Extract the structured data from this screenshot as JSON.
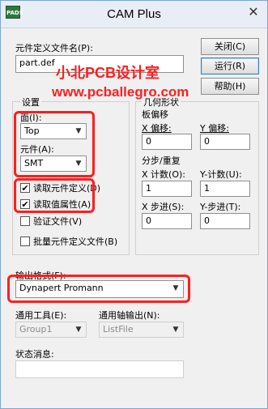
{
  "window": {
    "title": "CAM Plus",
    "app_icon_text": "PADS",
    "close_glyph": "✕"
  },
  "file": {
    "label": "元件定义文件名(P):",
    "value": "part.def"
  },
  "buttons": {
    "close": "关闭(C)",
    "run": "运行(R)",
    "help": "帮助(H)"
  },
  "settings": {
    "group_label": "设置",
    "side_label": "面(I):",
    "side_value": "Top",
    "component_label": "元件(A):",
    "component_value": "SMT",
    "checks": [
      {
        "label": "读取元件定义(D)",
        "checked": true
      },
      {
        "label": "读取值属性(A)",
        "checked": true
      },
      {
        "label": "验证文件(V)",
        "checked": false
      },
      {
        "label": "批量元件定义文件(B)",
        "checked": false
      }
    ]
  },
  "geometry": {
    "group_label": "几何形状",
    "board_offset_label": "板偏移",
    "x_offset_label": "X 偏移:",
    "x_offset_value": "0",
    "y_offset_label": "Y 偏移:",
    "y_offset_value": "0",
    "step_repeat_label": "分步/重复",
    "x_count_label": "X 计数(O):",
    "x_count_value": "1",
    "y_count_label": "Y-计数(U):",
    "y_count_value": "1",
    "x_step_label": "X 步进(S):",
    "x_step_value": "0",
    "y_step_label": "Y-步进(T):",
    "y_step_value": "0"
  },
  "output": {
    "format_label": "输出格式(F):",
    "format_value": "Dynapert Promann",
    "tool_label": "通用工具(E):",
    "tool_value": "Group1",
    "axis_label": "通用轴输出(N):",
    "axis_value": "ListFile"
  },
  "status": {
    "label": "状态消息:",
    "value": ""
  },
  "watermark": {
    "line1": "小北PCB设计室",
    "line2": "www.pcballegro.com"
  },
  "icons": {
    "dropdown": "chevron-down-icon",
    "checkbox": "check-icon"
  },
  "colors": {
    "highlight": "#ff1e1e",
    "titlebar": "#e9eef6"
  }
}
